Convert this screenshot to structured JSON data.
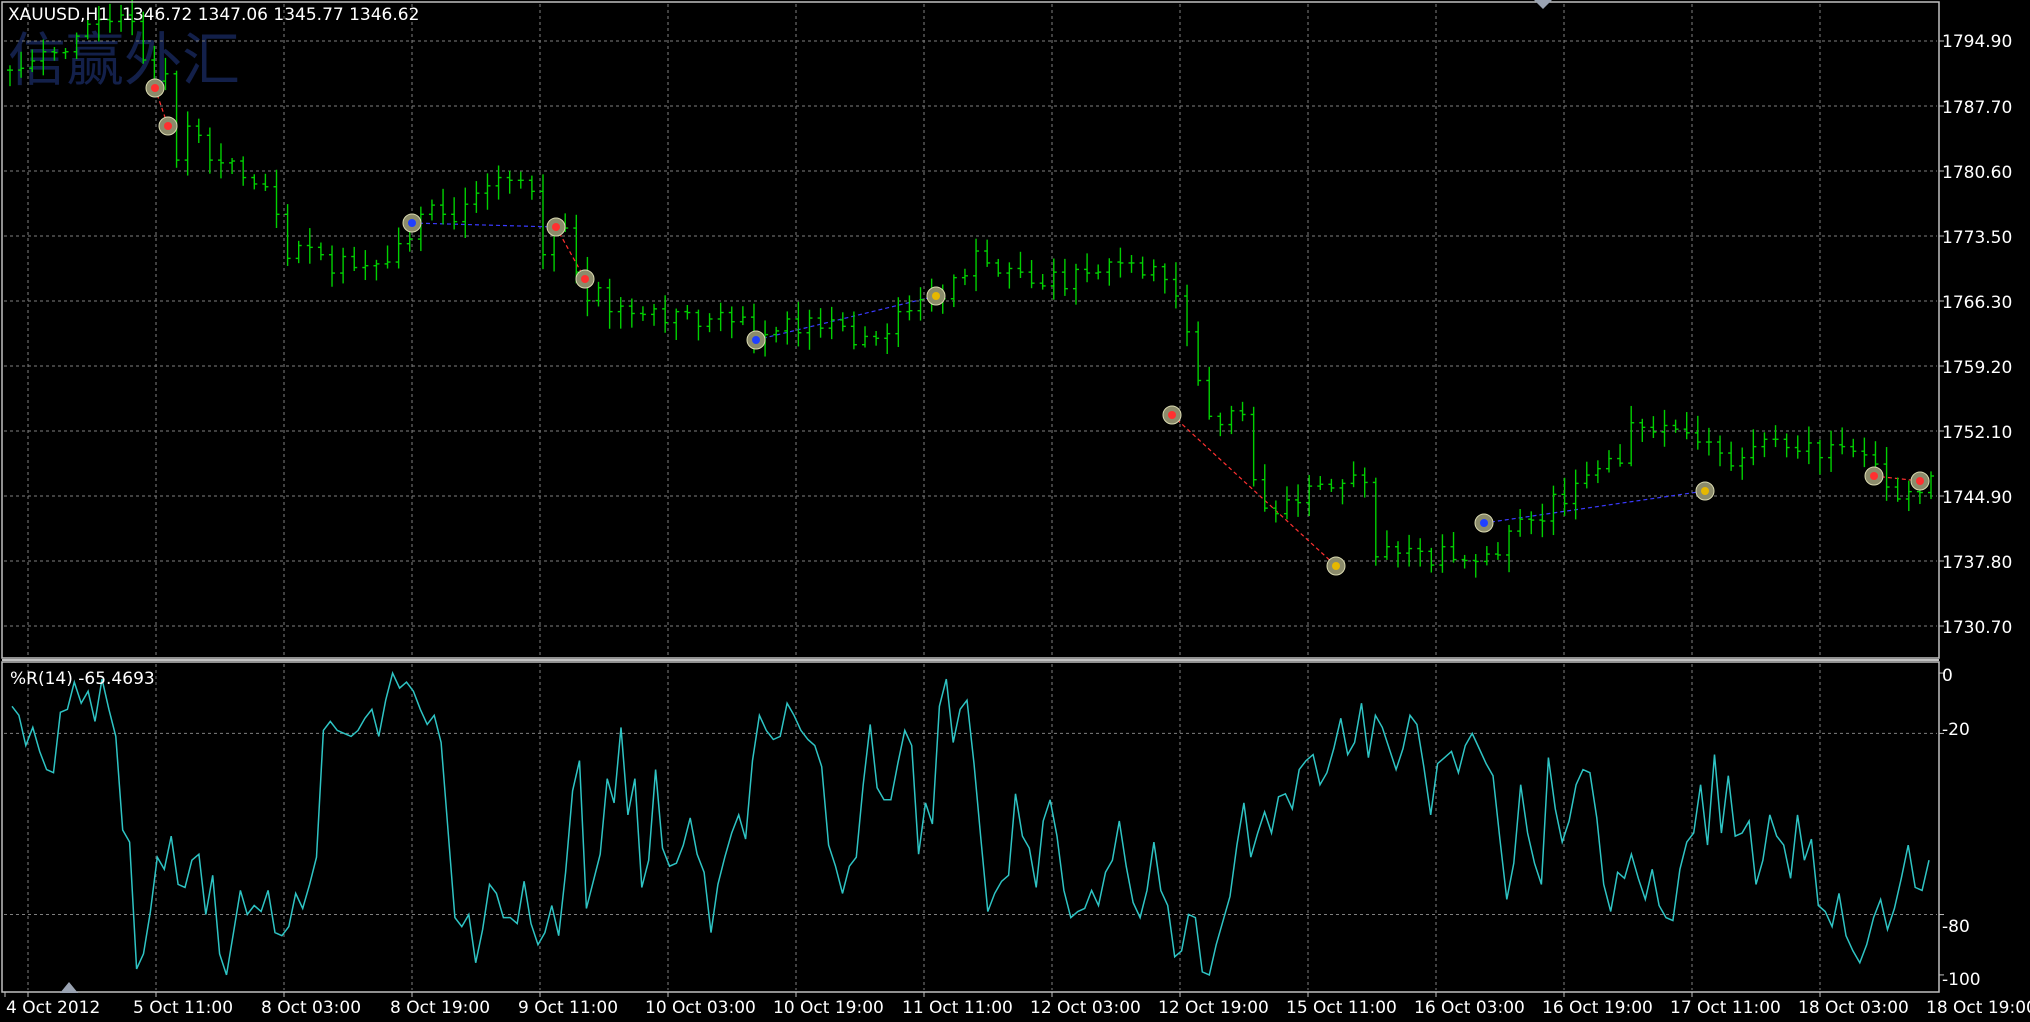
{
  "window": {
    "symbol_label": "XAUUSD,H1",
    "ohlc_label": "1346.72 1347.06 1345.77 1346.62",
    "watermark": "信赢外汇",
    "indicator_label": "%R(14) -65.4693"
  },
  "colors": {
    "background": "#000000",
    "grid": "#7f7f7f",
    "axis": "#c0c0c0",
    "text": "#ffffff",
    "bar": "#00d000",
    "wpr_line": "#2ec4c4",
    "watermark": "#13204a",
    "zigzag_down": "#ff3030",
    "zigzag_up": "#3a3aff"
  },
  "price_axis": {
    "labels": [
      "1794.90",
      "1787.70",
      "1780.60",
      "1773.50",
      "1766.30",
      "1759.20",
      "1752.10",
      "1744.90",
      "1737.80",
      "1730.70"
    ]
  },
  "indicator_axis": {
    "labels": [
      "0",
      "-20",
      "-80",
      "-100"
    ]
  },
  "time_axis": {
    "labels": [
      "4 Oct 2012",
      "5 Oct 11:00",
      "8 Oct 03:00",
      "8 Oct 19:00",
      "9 Oct 11:00",
      "10 Oct 03:00",
      "10 Oct 19:00",
      "11 Oct 11:00",
      "12 Oct 03:00",
      "12 Oct 19:00",
      "15 Oct 11:00",
      "16 Oct 03:00",
      "16 Oct 19:00",
      "17 Oct 11:00",
      "18 Oct 03:00",
      "18 Oct 19:00"
    ]
  },
  "chart_data": [
    {
      "type": "line",
      "subtype": "ohlc-bars",
      "title": "XAUUSD,H1",
      "x_ticks": [
        "4 Oct 2012",
        "5 Oct 11:00",
        "8 Oct 03:00",
        "8 Oct 19:00",
        "9 Oct 11:00",
        "10 Oct 03:00",
        "10 Oct 19:00",
        "11 Oct 11:00",
        "12 Oct 03:00",
        "12 Oct 19:00",
        "15 Oct 11:00",
        "16 Oct 03:00",
        "16 Oct 19:00",
        "17 Oct 11:00",
        "18 Oct 03:00",
        "18 Oct 19:00"
      ],
      "ylim": [
        1727.0,
        1798.0
      ],
      "grid": true,
      "series": [
        {
          "values": [
            1790.8,
            1791.0,
            1791.8,
            1792.8,
            1792.7,
            1792.8,
            1794.5,
            1795.8,
            1796.3,
            1796.1,
            1796.8,
            1796.1,
            1791.9,
            1789.6,
            1790.4,
            1781.0,
            1784.7,
            1783.7,
            1781.0,
            1780.7,
            1780.9,
            1779.1,
            1778.4,
            1778.1,
            1775.1,
            1770.3,
            1771.7,
            1771.5,
            1770.7,
            1768.7,
            1770.5,
            1769.3,
            1769.5,
            1769.7,
            1769.9,
            1771.9,
            1772.4,
            1775.1,
            1776.1,
            1775.1,
            1774.3,
            1776.2,
            1777.4,
            1778.2,
            1779.1,
            1778.8,
            1778.8,
            1777.6,
            1770.7,
            1773.7,
            1773.6,
            1768.8,
            1765.7,
            1767.1,
            1764.5,
            1765.1,
            1764.3,
            1764.2,
            1764.8,
            1763.3,
            1764.5,
            1764.4,
            1762.9,
            1763.7,
            1764.4,
            1763.4,
            1763.9,
            1761.5,
            1762.0,
            1762.4,
            1763.7,
            1762.2,
            1763.8,
            1762.7,
            1763.6,
            1762.9,
            1760.9,
            1761.8,
            1761.6,
            1762.1,
            1764.5,
            1764.6,
            1765.8,
            1766.4,
            1765.9,
            1768.2,
            1768.4,
            1771.1,
            1769.8,
            1768.7,
            1769.2,
            1768.8,
            1767.6,
            1767.3,
            1768.8,
            1767.0,
            1769.1,
            1768.7,
            1768.8,
            1769.9,
            1769.8,
            1769.8,
            1768.5,
            1769.4,
            1768.0,
            1766.2,
            1762.3,
            1757.0,
            1753.1,
            1752.2,
            1753.7,
            1753.3,
            1746.2,
            1743.1,
            1742.5,
            1744.0,
            1743.7,
            1745.5,
            1745.7,
            1745.3,
            1745.8,
            1746.7,
            1745.9,
            1737.8,
            1738.9,
            1738.2,
            1738.7,
            1738.4,
            1736.9,
            1738.9,
            1737.5,
            1737.4,
            1737.3,
            1738.1,
            1738.0,
            1740.6,
            1741.9,
            1741.8,
            1741.7,
            1744.6,
            1743.6,
            1745.8,
            1746.7,
            1747.4,
            1748.5,
            1748.0,
            1752.4,
            1751.9,
            1751.4,
            1752.1,
            1751.7,
            1751.3,
            1750.3,
            1750.3,
            1749.1,
            1747.7,
            1748.6,
            1749.8,
            1750.6,
            1750.6,
            1749.7,
            1749.3,
            1750.2,
            1748.6,
            1750.0,
            1749.8,
            1749.3,
            1748.9,
            1747.9,
            1745.4,
            1744.1,
            1744.9,
            1744.8,
            1746.6
          ]
        }
      ]
    },
    {
      "type": "line",
      "title": "%R(14) -65.4693",
      "x_ticks": [
        "4 Oct 2012",
        "5 Oct 11:00",
        "8 Oct 03:00",
        "8 Oct 19:00",
        "9 Oct 11:00",
        "10 Oct 03:00",
        "10 Oct 19:00",
        "11 Oct 11:00",
        "12 Oct 03:00",
        "12 Oct 19:00",
        "15 Oct 11:00",
        "16 Oct 03:00",
        "16 Oct 19:00",
        "17 Oct 11:00",
        "18 Oct 03:00",
        "18 Oct 19:00"
      ],
      "y_ticks": [
        0,
        -20,
        -80,
        -100
      ],
      "ylim": [
        -105,
        3
      ],
      "grid": true,
      "series": [
        {
          "name": "%R(14)",
          "values": [
            -11,
            -14,
            -24,
            -18,
            -26,
            -32,
            -33,
            -13,
            -12,
            -3,
            -10,
            -6,
            -16,
            -2,
            -12,
            -21,
            -52,
            -56,
            -98,
            -93,
            -79,
            -61,
            -65,
            -54,
            -70,
            -71,
            -62,
            -60,
            -80,
            -67,
            -93,
            -100,
            -86,
            -72,
            -80,
            -77,
            -79,
            -72,
            -86,
            -87,
            -84,
            -73,
            -78,
            -70,
            -61,
            -19,
            -16,
            -19,
            -20,
            -21,
            -19,
            -15,
            -12,
            -21,
            -9,
            0,
            -5,
            -3,
            -6,
            -12,
            -17,
            -14,
            -23,
            -52,
            -81,
            -84,
            -80,
            -96,
            -85,
            -70,
            -73,
            -81,
            -81,
            -83,
            -69,
            -83,
            -90,
            -86,
            -77,
            -87,
            -66,
            -39,
            -29,
            -78,
            -69,
            -60,
            -35,
            -43,
            -18,
            -47,
            -35,
            -71,
            -62,
            -32,
            -58,
            -64,
            -63,
            -57,
            -48,
            -60,
            -66,
            -86,
            -70,
            -61,
            -53,
            -47,
            -55,
            -29,
            -14,
            -19,
            -22,
            -21,
            -10,
            -14,
            -19,
            -22,
            -24,
            -31,
            -57,
            -64,
            -73,
            -64,
            -61,
            -37,
            -17,
            -38,
            -42,
            -42,
            -30,
            -19,
            -24,
            -60,
            -43,
            -50,
            -11,
            -2,
            -23,
            -12,
            -9,
            -30,
            -55,
            -79,
            -73,
            -69,
            -67,
            -40,
            -54,
            -58,
            -71,
            -49,
            -42,
            -54,
            -72,
            -81,
            -79,
            -78,
            -72,
            -77,
            -66,
            -62,
            -49,
            -64,
            -76,
            -81,
            -72,
            -56,
            -72,
            -77,
            -94,
            -92,
            -80,
            -81,
            -99,
            -100,
            -90,
            -82,
            -74,
            -57,
            -43,
            -61,
            -53,
            -46,
            -53,
            -41,
            -40,
            -45,
            -32,
            -29,
            -27,
            -37,
            -33,
            -25,
            -15,
            -27,
            -23,
            -10,
            -28,
            -14,
            -18,
            -25,
            -32,
            -25,
            -14,
            -17,
            -31,
            -47,
            -30,
            -28,
            -26,
            -33,
            -24,
            -20,
            -25,
            -30,
            -34,
            -55,
            -75,
            -63,
            -37,
            -53,
            -63,
            -70,
            -28,
            -45,
            -56,
            -49,
            -37,
            -32,
            -33,
            -48,
            -70,
            -79,
            -66,
            -68,
            -60,
            -68,
            -75,
            -65,
            -77,
            -81,
            -82,
            -65,
            -56,
            -53,
            -37,
            -57,
            -27,
            -53,
            -34,
            -54,
            -53,
            -49,
            -70,
            -62,
            -47,
            -54,
            -57,
            -68,
            -47,
            -62,
            -55,
            -77,
            -79,
            -84,
            -73,
            -87,
            -92,
            -96,
            -90,
            -81,
            -75,
            -85,
            -78,
            -68,
            -57,
            -71,
            -72,
            -62
          ]
        }
      ]
    }
  ]
}
